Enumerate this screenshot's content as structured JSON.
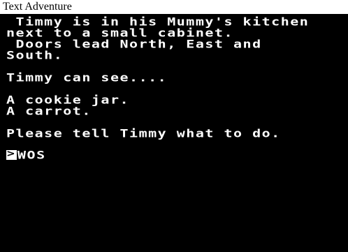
{
  "window": {
    "title": "Text Adventure"
  },
  "screen": {
    "lines": [
      " Timmy is in his Mummy's kitchen",
      "next to a small cabinet.",
      " Doors lead North, East and",
      "South.",
      "Timmy can see....",
      "A cookie jar.",
      "A carrot.",
      "Please tell Timmy what to do."
    ],
    "prompt_symbol": ">",
    "command_value": "WOS"
  },
  "colors": {
    "screen_background": "#000000",
    "screen_text": "#ffffff",
    "title_background": "#ffffff",
    "title_text": "#000000"
  }
}
